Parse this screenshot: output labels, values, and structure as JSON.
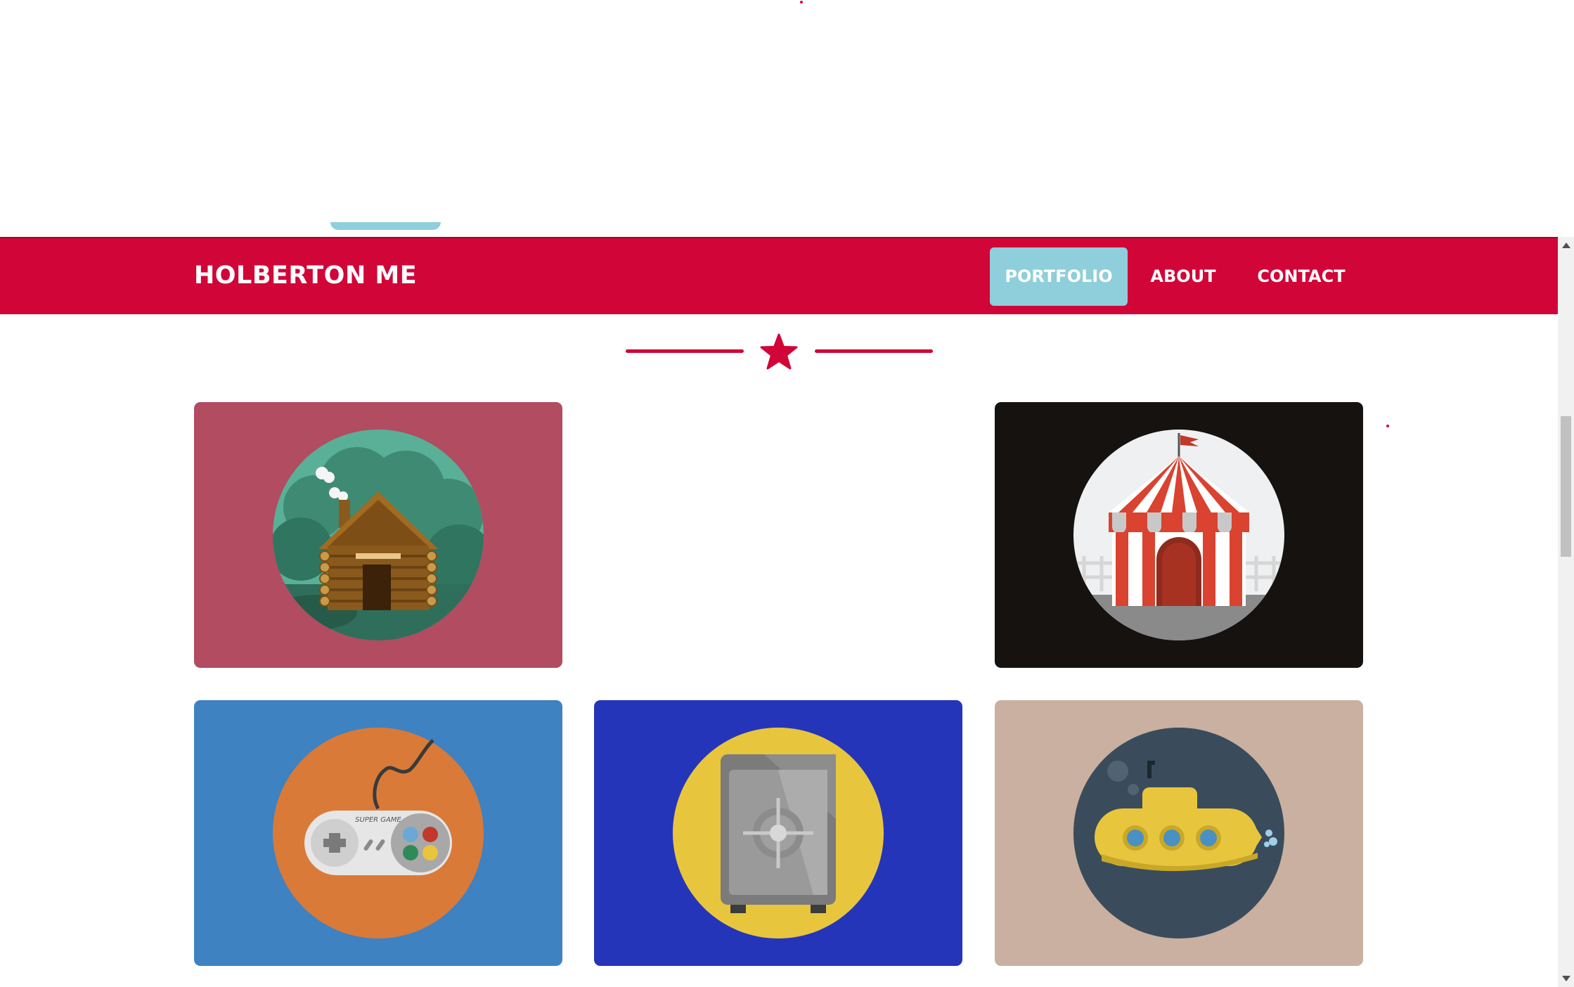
{
  "navbar": {
    "brand": "HOLBERTON ME",
    "items": [
      {
        "label": "PORTFOLIO",
        "active": true
      },
      {
        "label": "ABOUT",
        "active": false
      },
      {
        "label": "CONTACT",
        "active": false
      }
    ]
  },
  "divider": {
    "icon": "star-icon"
  },
  "portfolio": {
    "tiles": [
      {
        "icon": "cabin-icon",
        "background": "#b14c61"
      },
      {
        "icon": "circus-tent-icon",
        "background": "#151210"
      },
      {
        "icon": "game-controller-icon",
        "background": "#3e82c2",
        "controller_text": "SUPER GAME"
      },
      {
        "icon": "safe-icon",
        "background": "#2535b9"
      },
      {
        "icon": "submarine-icon",
        "background": "#cab0a0"
      }
    ]
  },
  "colors": {
    "primary": "#d10538",
    "accent": "#8ecfdb"
  }
}
